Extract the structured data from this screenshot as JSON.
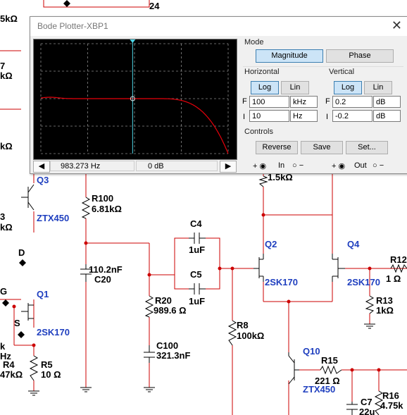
{
  "window": {
    "title": "Bode Plotter-XBP1",
    "close_glyph": "✕"
  },
  "mode": {
    "title": "Mode",
    "magnitude_label": "Magnitude",
    "phase_label": "Phase",
    "selected": "Magnitude"
  },
  "horizontal": {
    "title": "Horizontal",
    "log_label": "Log",
    "lin_label": "Lin",
    "scale": "Log",
    "final_label": "F",
    "initial_label": "I",
    "final_value": "100",
    "final_unit": "kHz",
    "initial_value": "10",
    "initial_unit": "Hz"
  },
  "vertical": {
    "title": "Vertical",
    "log_label": "Log",
    "lin_label": "Lin",
    "scale": "Log",
    "final_label": "F",
    "initial_label": "I",
    "final_value": "0.2",
    "final_unit": "dB",
    "initial_value": "-0.2",
    "initial_unit": "dB"
  },
  "controls": {
    "title": "Controls",
    "reverse_label": "Reverse",
    "save_label": "Save",
    "set_label": "Set..."
  },
  "readout": {
    "left_arrow": "◀",
    "right_arrow": "▶",
    "frequency": "983.273 Hz",
    "magnitude": "0 dB"
  },
  "terminals": {
    "in_label": "In",
    "out_label": "Out",
    "plus": "+",
    "minus": "−"
  },
  "plot": {
    "cursor_fraction": 0.49,
    "background": "#000000",
    "trace_color": "#e8000b",
    "cursor_color": "#4fd6e6"
  },
  "schematic": {
    "net_24": "24",
    "top_left_value": "5kΩ",
    "r7_name": "7",
    "r7_value": "kΩ",
    "left_kohm": "kΩ",
    "q3": "Q3",
    "q3_part": "ZTX450",
    "left_3": "3",
    "left_3_value": "kΩ",
    "d_label": "D",
    "g_label": "G",
    "s_label": "S",
    "q1": "Q1",
    "q1_part": "2SK170",
    "k_label": "k",
    "hz_label": "Hz",
    "r4_name": "R4",
    "r4_value": "47kΩ",
    "r5_name": "R5",
    "r5_value": "10 Ω",
    "r100_name": "R100",
    "r100_value": "6.81kΩ",
    "c20_value": "110.2nF",
    "c20_name": "C20",
    "c4_name": "C4",
    "c4_value": "1uF",
    "c5_name": "C5",
    "c5_value": "1uF",
    "r20_name": "R20",
    "r20_value": "989.6 Ω",
    "c100_name": "C100",
    "c100_value": "321.3nF",
    "r8_name": "R8",
    "r8_value": "100kΩ",
    "r_top_value": "1.5kΩ",
    "q2": "Q2",
    "q2_part": "2SK170",
    "q4": "Q4",
    "q4_part": "2SK170",
    "r12_name": "R12",
    "r12_value": "1 Ω",
    "r13_name": "R13",
    "r13_value": "1kΩ",
    "q10": "Q10",
    "q10_part": "ZTX450",
    "r15_name": "R15",
    "r15_value": "221 Ω",
    "c7_name": "C7",
    "c7_value": "22u",
    "r16_name": "R16",
    "r16_value": "4.75k"
  }
}
